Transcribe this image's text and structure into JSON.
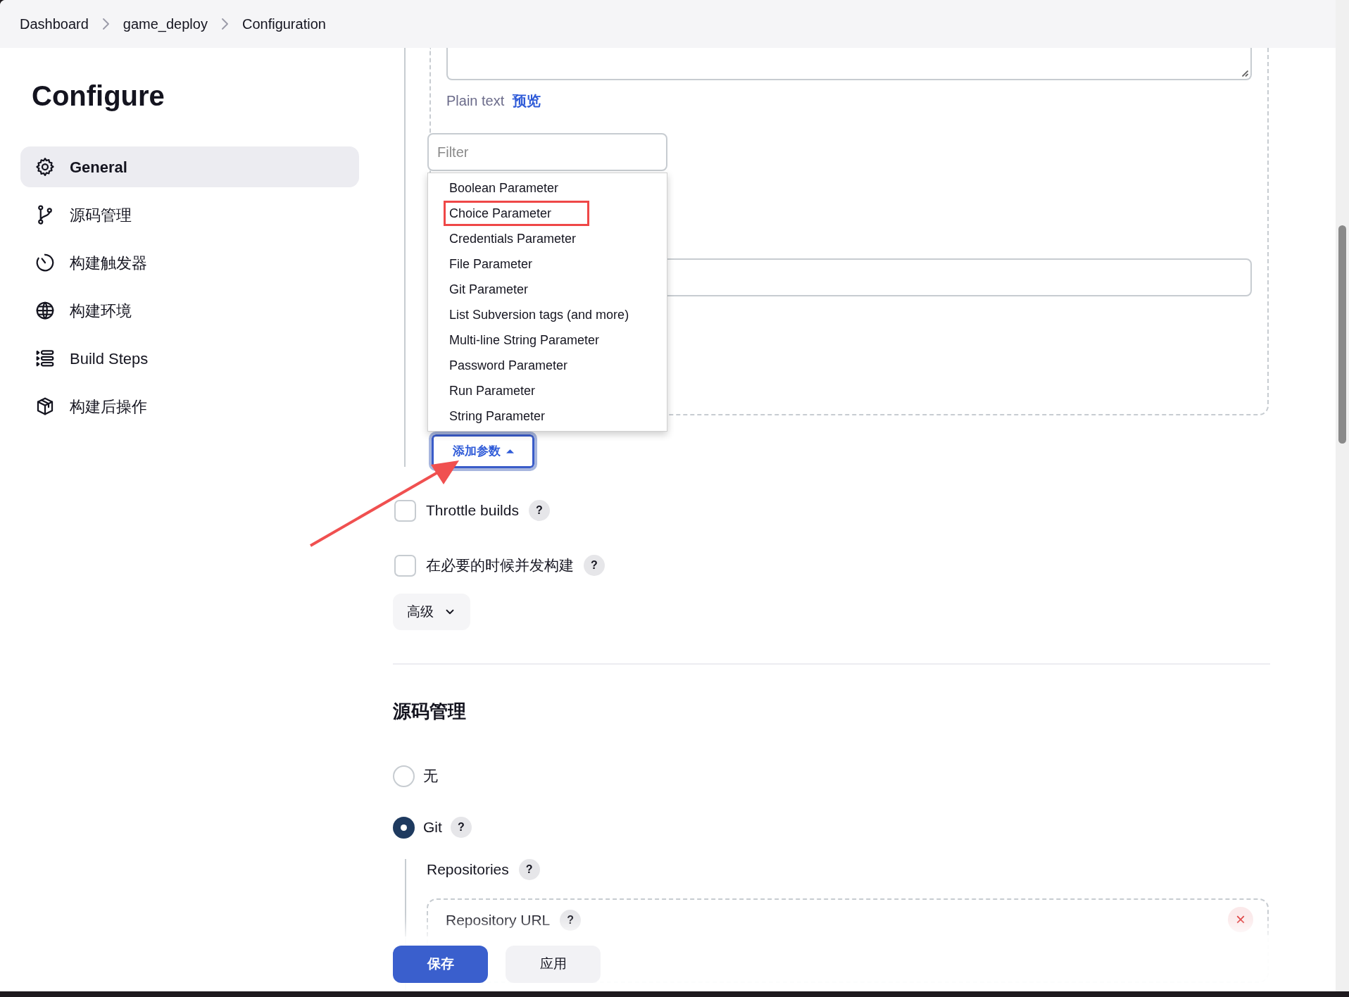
{
  "breadcrumbs": [
    {
      "label": "Dashboard"
    },
    {
      "label": "game_deploy"
    },
    {
      "label": "Configuration"
    }
  ],
  "sidebar": {
    "title": "Configure",
    "items": [
      {
        "label": "General",
        "selected": true
      },
      {
        "label": "源码管理",
        "selected": false
      },
      {
        "label": "构建触发器",
        "selected": false
      },
      {
        "label": "构建环境",
        "selected": false
      },
      {
        "label": "Build Steps",
        "selected": false
      },
      {
        "label": "构建后操作",
        "selected": false
      }
    ]
  },
  "description": {
    "format": "Plain text",
    "preview_link": "预览"
  },
  "parameter_menu": {
    "filter_placeholder": "Filter",
    "expanded": true,
    "button": "添加参数",
    "items": [
      {
        "label": "Boolean Parameter",
        "highlighted": false
      },
      {
        "label": "Choice Parameter",
        "highlighted": true
      },
      {
        "label": "Credentials Parameter",
        "highlighted": false
      },
      {
        "label": "File Parameter",
        "highlighted": false
      },
      {
        "label": "Git Parameter",
        "highlighted": false
      },
      {
        "label": "List Subversion tags (and more)",
        "highlighted": false
      },
      {
        "label": "Multi-line String Parameter",
        "highlighted": false
      },
      {
        "label": "Password Parameter",
        "highlighted": false
      },
      {
        "label": "Run Parameter",
        "highlighted": false
      },
      {
        "label": "String Parameter",
        "highlighted": false
      }
    ]
  },
  "options": [
    {
      "label": "Throttle builds",
      "checked": false,
      "help": "?"
    },
    {
      "label": "在必要的时候并发构建",
      "checked": false,
      "help": "?"
    }
  ],
  "advanced_button": "高级",
  "scm": {
    "title": "源码管理",
    "choices": [
      {
        "label": "无",
        "selected": false
      },
      {
        "label": "Git",
        "selected": true,
        "help": "?"
      }
    ],
    "repositories": {
      "label": "Repositories",
      "help": "?",
      "url_label": "Repository URL",
      "url_help": "?",
      "remove": "×"
    }
  },
  "footer": {
    "buttons": [
      {
        "label": "保存",
        "kind": "primary"
      },
      {
        "label": "应用",
        "kind": "secondary"
      }
    ]
  }
}
